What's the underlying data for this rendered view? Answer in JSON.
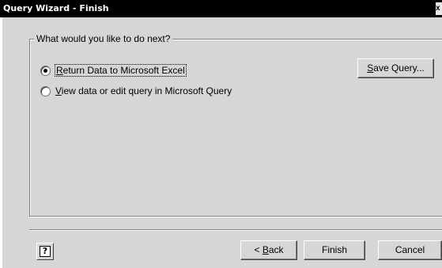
{
  "window": {
    "title": "Query Wizard - Finish",
    "close_glyph": "x"
  },
  "group": {
    "legend": "What would you like to do next?"
  },
  "options": [
    {
      "accel": "R",
      "rest": "eturn Data to Microsoft Excel",
      "checked": true
    },
    {
      "accel": "V",
      "rest": "iew data or edit query in Microsoft Query",
      "checked": false
    }
  ],
  "buttons": {
    "save_query": {
      "accel": "S",
      "rest": "ave Query..."
    },
    "back": {
      "prefix": "< ",
      "accel": "B",
      "rest": "ack"
    },
    "finish": "Finish",
    "cancel": "Cancel",
    "help_glyph": "?"
  },
  "colors": {
    "titlebar": "#000000",
    "dialog_bg": "#d6d6d6"
  }
}
